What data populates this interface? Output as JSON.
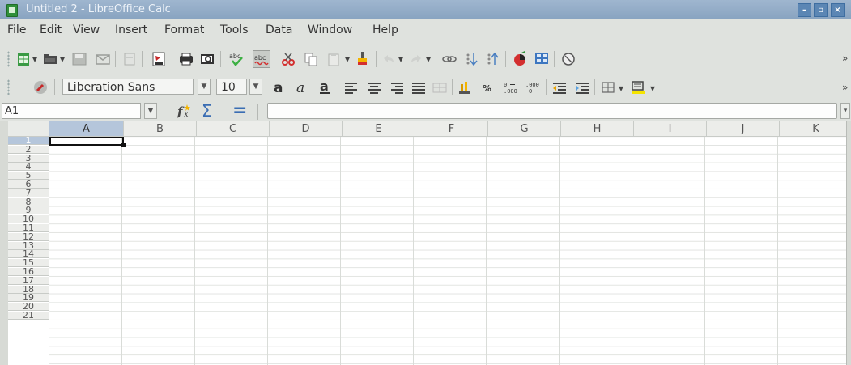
{
  "window": {
    "title": "Untitled 2 - LibreOffice Calc",
    "controls": [
      "–",
      "▫",
      "×"
    ]
  },
  "menubar": [
    "File",
    "Edit",
    "View",
    "Insert",
    "Format",
    "Tools",
    "Data",
    "Window",
    "Help"
  ],
  "formatting": {
    "font_name": "Liberation Sans",
    "font_size": "10"
  },
  "formula_bar": {
    "name_box": "A1",
    "sum_symbol": "Σ",
    "equals_symbol": "=",
    "formula_value": ""
  },
  "toolbar_overflow": "»",
  "columns": [
    "A",
    "B",
    "C",
    "D",
    "E",
    "F",
    "G",
    "H",
    "I",
    "J",
    "K"
  ],
  "rows": [
    "1",
    "2",
    "3",
    "4",
    "5",
    "6",
    "7",
    "8",
    "9",
    "10",
    "11",
    "12",
    "13",
    "14",
    "15",
    "16",
    "17",
    "18",
    "19",
    "20",
    "21"
  ],
  "selected_cell": "A1",
  "icons": {
    "standard_toolbar": [
      "new-spreadsheet-icon",
      "open-folder-icon",
      "save-icon",
      "email-icon",
      "edit-file-icon",
      "export-pdf-icon",
      "print-icon",
      "print-preview-icon",
      "spellcheck-icon",
      "autospellcheck-icon",
      "cut-icon",
      "copy-icon",
      "paste-icon",
      "clone-formatting-icon",
      "undo-icon",
      "redo-icon",
      "hyperlink-icon",
      "sort-ascending-icon",
      "sort-descending-icon",
      "insert-chart-icon",
      "pivot-table-icon",
      "navigator-icon"
    ],
    "formatting_toolbar": [
      "styles-icon",
      "bold-icon",
      "italic-icon",
      "underline-icon",
      "align-left-icon",
      "align-center-icon",
      "align-right-icon",
      "justify-icon",
      "merge-cells-icon",
      "currency-icon",
      "percent-icon",
      "add-decimal-icon",
      "remove-decimal-icon",
      "decrease-indent-icon",
      "increase-indent-icon",
      "borders-icon",
      "background-color-icon"
    ]
  },
  "colors": {
    "titlebar": "#8fa9c5",
    "chrome": "#dfe2de",
    "selection": "#b5c6db",
    "pdf_red": "#c62828",
    "calc_green": "#2f8f3a"
  }
}
